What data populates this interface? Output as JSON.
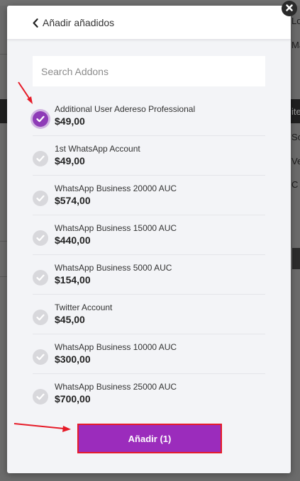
{
  "background": {
    "right_texts": [
      "Lo",
      "Ma",
      "ite",
      "So",
      "Ve",
      "C"
    ]
  },
  "modal": {
    "back_label": "Añadir añadidos",
    "search": {
      "placeholder": "Search Addons",
      "value": ""
    },
    "addons": [
      {
        "name": "Additional User Adereso Professional",
        "price": "$49,00",
        "selected": true
      },
      {
        "name": "1st WhatsApp Account",
        "price": "$49,00",
        "selected": false
      },
      {
        "name": "WhatsApp Business 20000 AUC",
        "price": "$574,00",
        "selected": false
      },
      {
        "name": "WhatsApp Business 15000 AUC",
        "price": "$440,00",
        "selected": false
      },
      {
        "name": "WhatsApp Business 5000 AUC",
        "price": "$154,00",
        "selected": false
      },
      {
        "name": "Twitter Account",
        "price": "$45,00",
        "selected": false
      },
      {
        "name": "WhatsApp Business 10000 AUC",
        "price": "$300,00",
        "selected": false
      },
      {
        "name": "WhatsApp Business 25000 AUC",
        "price": "$700,00",
        "selected": false
      }
    ],
    "add_button_label": "Añadir (1)"
  },
  "icons": {
    "back": "chevron-left-icon",
    "close": "close-icon",
    "check": "check-icon",
    "annotation": "red-arrow-icon"
  },
  "colors": {
    "accent": "#9b2cbc",
    "selected_check": "#8e3bb7",
    "annotation_red": "#e61b28",
    "modal_bg": "#f3f4f7"
  }
}
